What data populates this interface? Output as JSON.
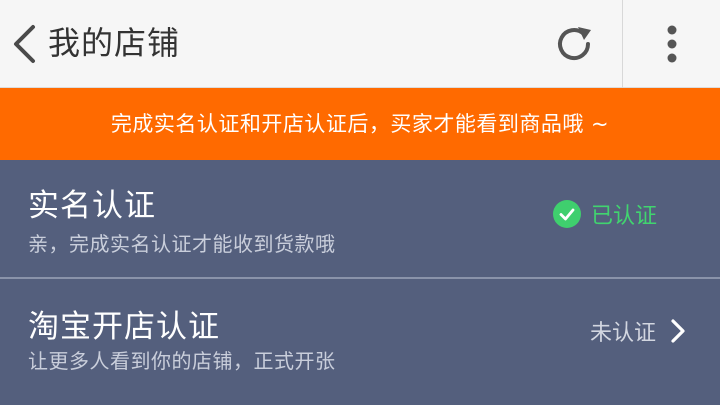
{
  "header": {
    "title": "我的店铺",
    "back_icon": "chevron-left-icon",
    "refresh_icon": "refresh-icon",
    "more_icon": "more-vertical-icon"
  },
  "notice": {
    "text": "完成实名认证和开店认证后，买家才能看到商品哦 ~",
    "background": "#ff6a00"
  },
  "rows": [
    {
      "title": "实名认证",
      "subtitle": "亲，完成实名认证才能收到货款哦",
      "status": "已认证",
      "status_icon": "check-circle-icon",
      "status_color": "#41d46f"
    },
    {
      "title": "淘宝开店认证",
      "subtitle": "让更多人看到你的店铺，正式开张",
      "status": "未认证",
      "status_icon": "chevron-right-icon",
      "status_color": "#d2d6e0"
    }
  ]
}
